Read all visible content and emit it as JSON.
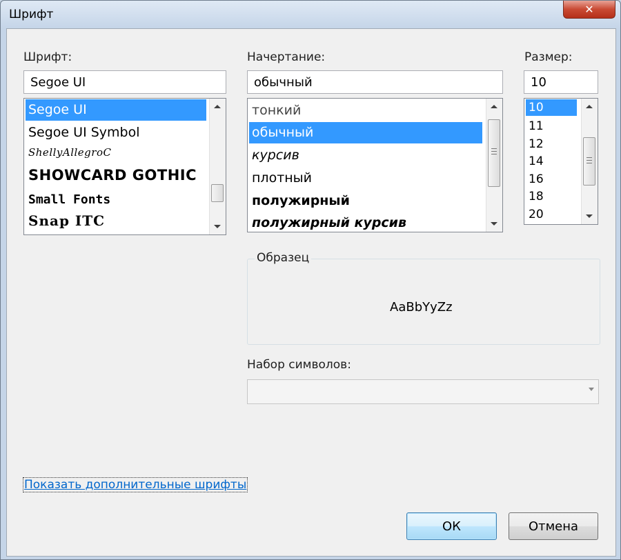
{
  "window": {
    "title": "Шрифт"
  },
  "font": {
    "label": "Шрифт:",
    "value": "Segoe UI",
    "items": [
      "Segoe UI",
      "Segoe UI Symbol",
      "ShellyAllegroC",
      "SHOWCARD GOTHIC",
      "Small Fonts",
      "Snap ITC"
    ]
  },
  "style": {
    "label": "Начертание:",
    "value": "обычный",
    "items": [
      "тонкий",
      "обычный",
      "курсив",
      "плотный",
      "полужирный",
      "полужирный курсив"
    ]
  },
  "size": {
    "label": "Размер:",
    "value": "10",
    "items": [
      "10",
      "11",
      "12",
      "14",
      "16",
      "18",
      "20"
    ]
  },
  "sample": {
    "label": "Образец",
    "text": "AaBbYyZz"
  },
  "charset": {
    "label": "Набор символов:",
    "value": ""
  },
  "link": {
    "text": "Показать дополнительные шрифты"
  },
  "buttons": {
    "ok": "ОК",
    "cancel": "Отмена"
  },
  "icons": {
    "close": "close-icon",
    "scroll_up": "arrow-up-icon",
    "scroll_down": "arrow-down-icon",
    "dropdown": "chevron-down-icon"
  },
  "colors": {
    "selection": "#3399ff",
    "link": "#0066cc",
    "close_button": "#c94a33"
  }
}
